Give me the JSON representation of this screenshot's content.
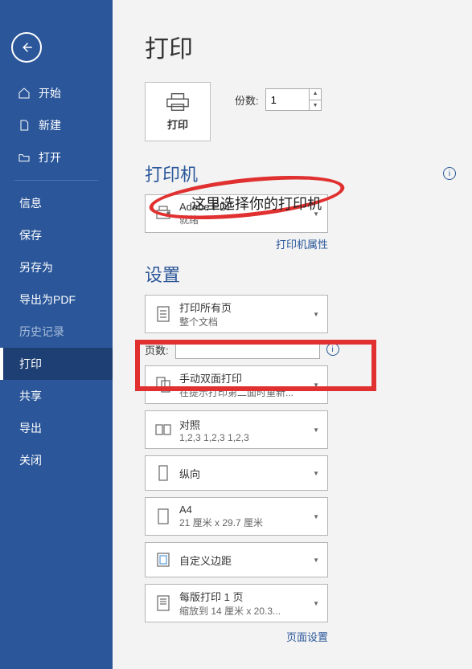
{
  "sidebar": {
    "items": [
      {
        "label": "开始"
      },
      {
        "label": "新建"
      },
      {
        "label": "打开"
      },
      {
        "label": "信息"
      },
      {
        "label": "保存"
      },
      {
        "label": "另存为"
      },
      {
        "label": "导出为PDF"
      },
      {
        "label": "历史记录"
      },
      {
        "label": "打印"
      },
      {
        "label": "共享"
      },
      {
        "label": "导出"
      },
      {
        "label": "关闭"
      }
    ]
  },
  "main": {
    "title": "打印",
    "print_button": "打印",
    "copies_label": "份数:",
    "copies_value": "1",
    "printer_section": "打印机",
    "printer": {
      "name": "Adobe PDF",
      "status": "就绪"
    },
    "printer_props": "打印机属性",
    "overlay": "这里选择你的打印机",
    "settings_section": "设置",
    "pages_label": "页数:",
    "options": [
      {
        "title": "打印所有页",
        "sub": "整个文档"
      },
      {
        "title": "手动双面打印",
        "sub": "在提示打印第二面时重新..."
      },
      {
        "title": "对照",
        "sub": "1,2,3    1,2,3    1,2,3"
      },
      {
        "title": "纵向",
        "sub": ""
      },
      {
        "title": "A4",
        "sub": "21 厘米 x 29.7 厘米"
      },
      {
        "title": "自定义边距",
        "sub": ""
      },
      {
        "title": "每版打印 1 页",
        "sub": "缩放到 14 厘米 x 20.3..."
      }
    ],
    "page_setup": "页面设置"
  }
}
